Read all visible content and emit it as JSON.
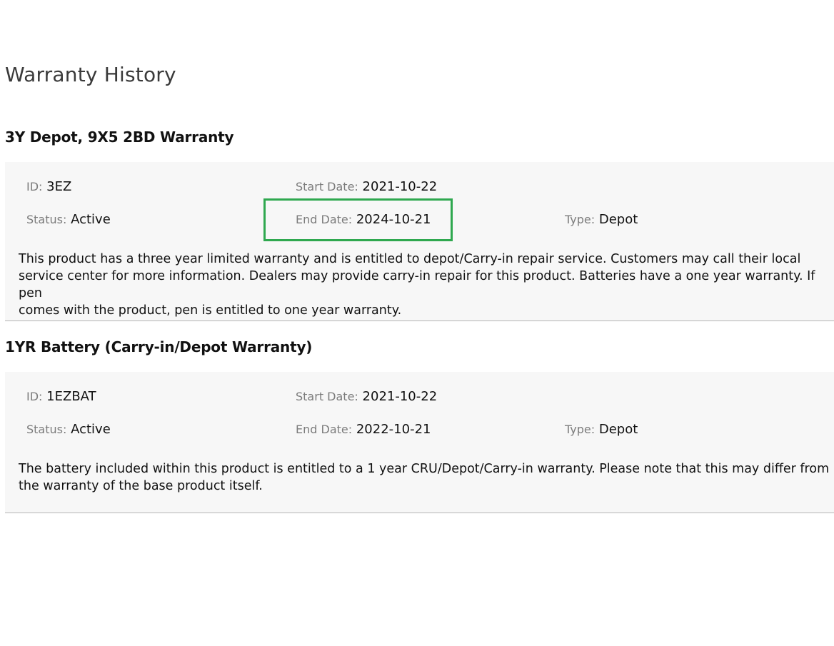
{
  "page": {
    "title": "Warranty History",
    "highlight_color": "#2fa84f"
  },
  "warranties": [
    {
      "name": "3Y Depot, 9X5 2BD Warranty",
      "id_label": "ID",
      "id_value": "3EZ",
      "start_label": "Start Date",
      "start_value": "2021-10-22",
      "status_label": "Status",
      "status_value": "Active",
      "end_label": "End Date",
      "end_value": "2024-10-21",
      "type_label": "Type",
      "type_value": "Depot",
      "description_lines": [
        "This product has a three year limited warranty and is entitled to depot/Carry-in repair service. Customers may call their local",
        "service center for more information. Dealers may provide carry-in repair for this product. Batteries have a one year warranty. If pen",
        "comes with the product, pen is entitled to one year warranty."
      ]
    },
    {
      "name": "1YR Battery (Carry-in/Depot Warranty)",
      "id_label": "ID",
      "id_value": "1EZBAT",
      "start_label": "Start Date",
      "start_value": "2021-10-22",
      "status_label": "Status",
      "status_value": "Active",
      "end_label": "End Date",
      "end_value": "2022-10-21",
      "type_label": "Type",
      "type_value": "Depot",
      "description_lines": [
        "The battery included within this product is entitled to a 1 year CRU/Depot/Carry-in warranty. Please note that this may differ from",
        "the warranty of the base product itself."
      ]
    }
  ]
}
